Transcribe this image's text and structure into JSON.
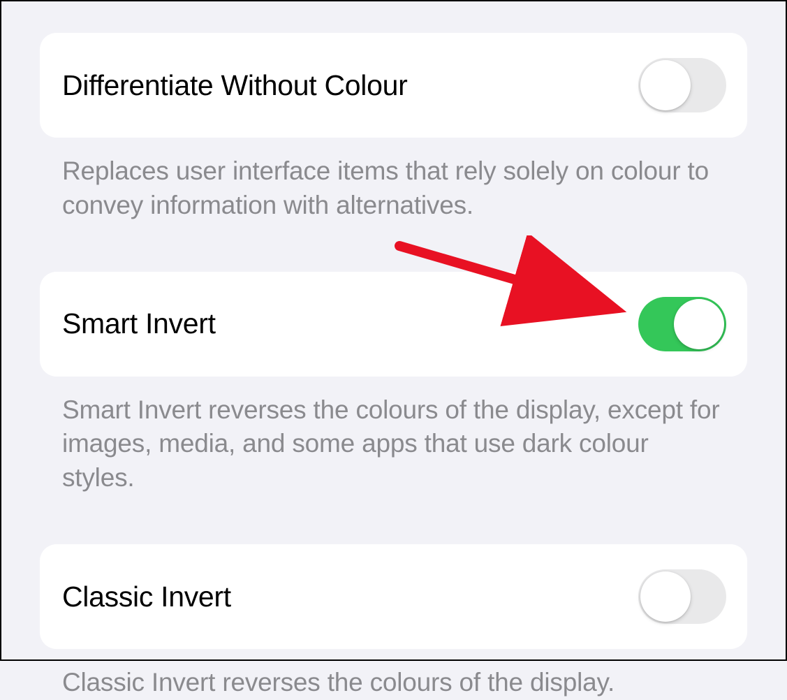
{
  "settings": [
    {
      "label": "Differentiate Without Colour",
      "description": "Replaces user interface items that rely solely on colour to convey information with alternatives.",
      "enabled": false
    },
    {
      "label": "Smart Invert",
      "description": "Smart Invert reverses the colours of the display, except for images, media, and some apps that use dark colour styles.",
      "enabled": true
    },
    {
      "label": "Classic Invert",
      "description": "Classic Invert reverses the colours of the display.",
      "enabled": false
    }
  ],
  "annotation": {
    "arrow_color": "#e81123"
  }
}
